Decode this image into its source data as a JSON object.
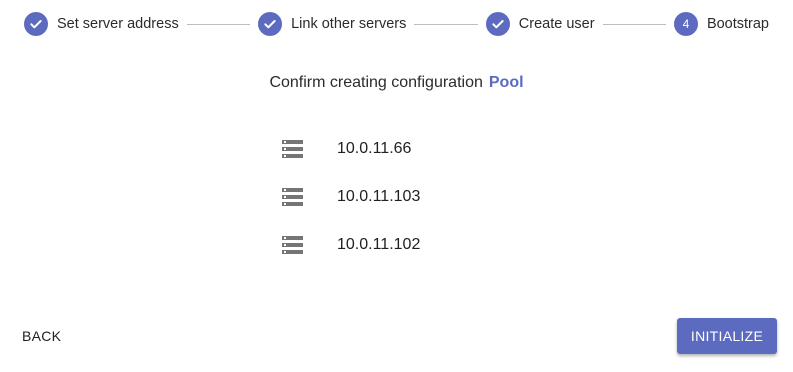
{
  "stepper": {
    "accent_color": "#5c6bc0",
    "steps": [
      {
        "label": "Set server address",
        "state": "completed",
        "icon": "check-icon"
      },
      {
        "label": "Link other servers",
        "state": "completed",
        "icon": "check-icon"
      },
      {
        "label": "Create user",
        "state": "completed",
        "icon": "check-icon"
      },
      {
        "label": "Bootstrap",
        "state": "active",
        "number": "4"
      }
    ]
  },
  "confirm": {
    "prefix": "Confirm creating configuration",
    "config_name": "Pool"
  },
  "servers": [
    {
      "icon": "server-icon",
      "ip": "10.0.11.66"
    },
    {
      "icon": "server-icon",
      "ip": "10.0.11.103"
    },
    {
      "icon": "server-icon",
      "ip": "10.0.11.102"
    }
  ],
  "actions": {
    "back_label": "BACK",
    "initialize_label": "INITIALIZE"
  }
}
